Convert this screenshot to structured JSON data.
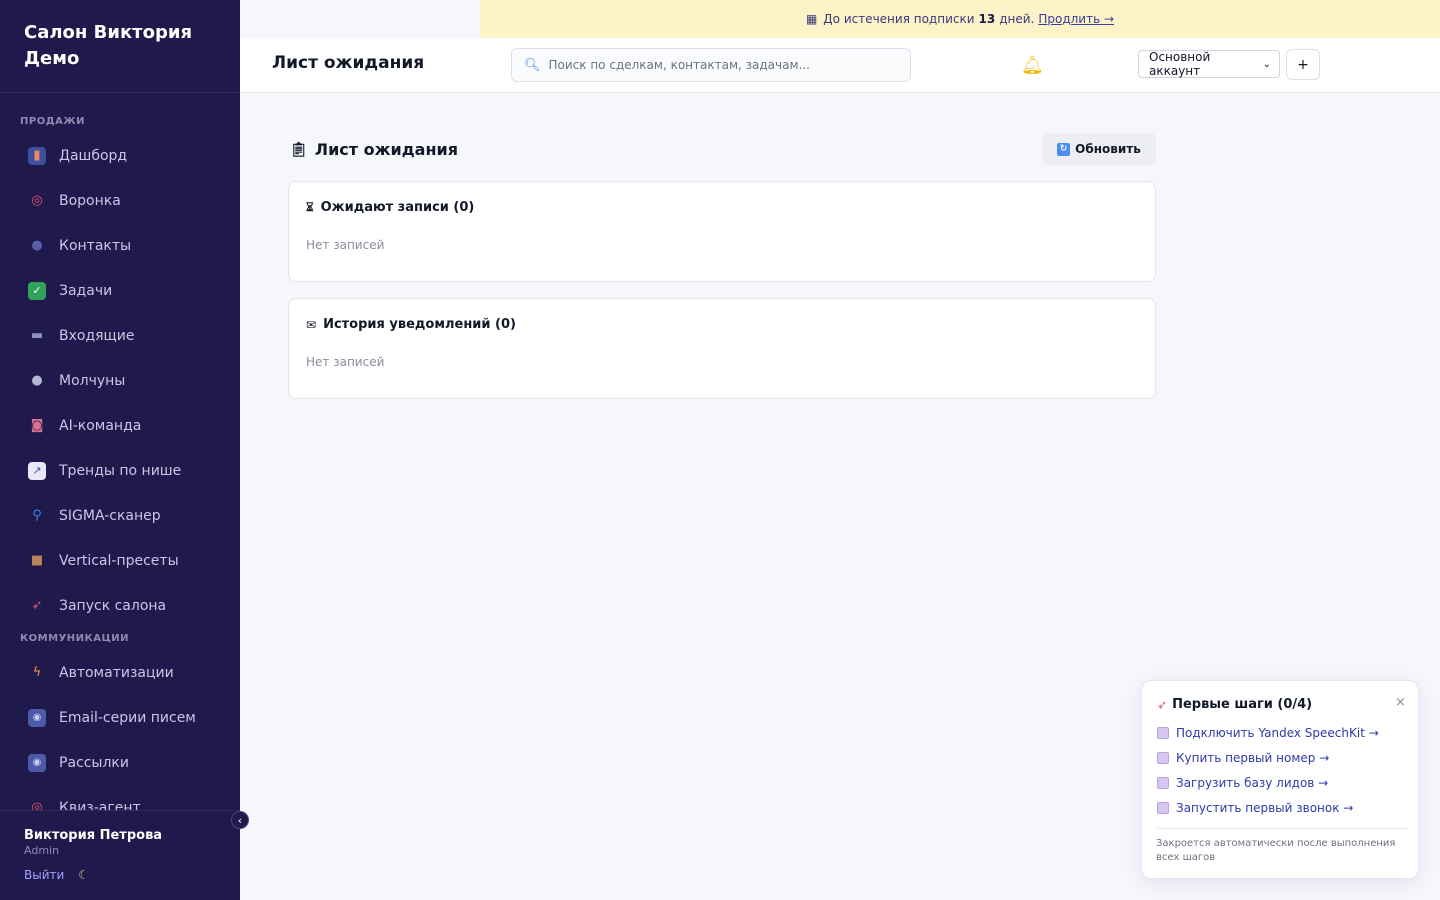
{
  "sidebar": {
    "brand": "Салон Виктория Демо",
    "sections": {
      "sales": "ПРОДАЖИ",
      "comm": "КОММУНИКАЦИИ"
    },
    "items": [
      {
        "label": "Дашборд",
        "icon": "bar-chart-icon"
      },
      {
        "label": "Воронка",
        "icon": "target-icon"
      },
      {
        "label": "Контакты",
        "icon": "people-icon"
      },
      {
        "label": "Задачи",
        "icon": "checkbox-icon"
      },
      {
        "label": "Входящие",
        "icon": "inbox-icon"
      },
      {
        "label": "Молчуны",
        "icon": "speech-bubble-icon"
      },
      {
        "label": "AI-команда",
        "icon": "robot-icon"
      },
      {
        "label": "Тренды по нише",
        "icon": "trend-up-icon"
      },
      {
        "label": "SIGMA-сканер",
        "icon": "magnifier-icon"
      },
      {
        "label": "Vertical-пресеты",
        "icon": "package-icon"
      },
      {
        "label": "Запуск салона",
        "icon": "rocket-icon"
      },
      {
        "label": "Автоматизации",
        "icon": "lightning-icon"
      },
      {
        "label": "Email-серии писем",
        "icon": "email-icon"
      },
      {
        "label": "Рассылки",
        "icon": "broadcast-icon"
      },
      {
        "label": "Квиз-агент",
        "icon": "quiz-icon"
      }
    ],
    "user": {
      "name": "Виктория Петрова",
      "role": "Admin",
      "logout": "Выйти"
    },
    "collapse_glyph": "‹"
  },
  "banner": {
    "prefix": "До истечения подписки",
    "days": "13",
    "suffix": "дней.",
    "link": "Продлить →"
  },
  "header": {
    "title": "Лист ожидания",
    "search_placeholder": "Поиск по сделкам, контактам, задачам...",
    "account": "Основной аккаунт",
    "plus": "+"
  },
  "main": {
    "title": "Лист ожидания",
    "refresh": "Обновить",
    "cards": [
      {
        "title": "Ожидают записи (0)",
        "empty": "Нет записей",
        "icon": "hourglass-icon"
      },
      {
        "title": "История уведомлений (0)",
        "empty": "Нет записей",
        "icon": "envelope-icon"
      }
    ]
  },
  "onboarding": {
    "title": "Первые шаги (0/4)",
    "close": "×",
    "steps": [
      "Подключить Yandex SpeechKit →",
      "Купить первый номер →",
      "Загрузить базу лидов →",
      "Запустить первый звонок →"
    ],
    "note": "Закроется автоматически после выполнения всех шагов"
  },
  "colors": {
    "sidebar_bg": "#1f1a4b",
    "banner_bg": "#fdf3c8",
    "link": "#2f3aa8"
  }
}
